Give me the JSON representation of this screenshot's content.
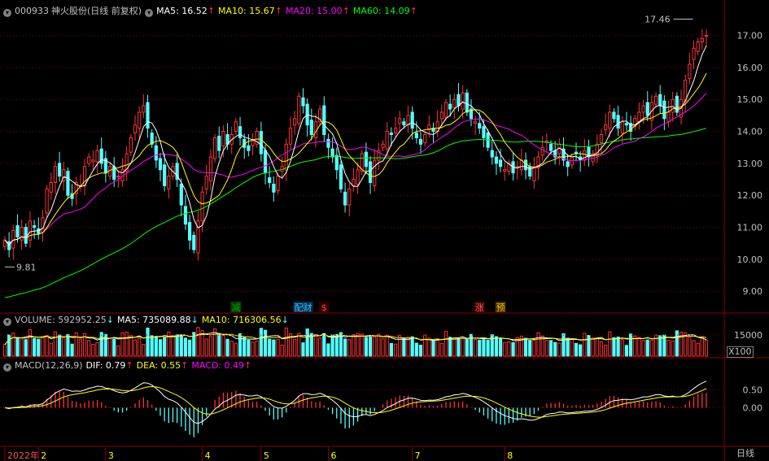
{
  "price_header": {
    "code": "000933",
    "name": "神火股份(日线 前复权)",
    "ma5": "MA5: 16.52",
    "ma10": "MA10: 15.67",
    "ma20": "MA20: 15.00",
    "ma60": "MA60: 14.09",
    "arrow_up": "↑"
  },
  "volume_header": {
    "label": "VOLUME: 592952.25",
    "ma5": "MA5: 735089.88",
    "ma10": "MA10: 716306.56",
    "arrow_down": "↓"
  },
  "macd_header": {
    "label": "MACD(12,26,9)",
    "dif": "DIF: 0.79",
    "dea": "DEA: 0.55",
    "macd": "MACD: 0.49",
    "arrow_up": "↑"
  },
  "annotations": {
    "high_label": "17.46",
    "low_label": "9.81",
    "events": [
      {
        "text": "减",
        "color": "#00a000",
        "bg": "#004000"
      },
      {
        "text": "配财",
        "color": "#40c0ff",
        "bg": "#003050"
      },
      {
        "text": "$",
        "color": "#ff4040",
        "bg": "#300000"
      },
      {
        "text": "涨",
        "color": "#ff6060",
        "bg": "#400000"
      },
      {
        "text": "预",
        "color": "#ffc000",
        "bg": "#403000"
      }
    ]
  },
  "axis": {
    "x_labels": [
      "2022年",
      "2",
      "3",
      "4",
      "5",
      "6",
      "7",
      "8"
    ],
    "period_label": "日线",
    "volume_unit": "X100",
    "volume_ticks": [
      "15000"
    ],
    "macd_ticks": [
      "0.50",
      "0.00"
    ]
  },
  "colors": {
    "up": "#ff3232",
    "down": "#54ffff",
    "ma5": "#ffffff",
    "ma10": "#ffff00",
    "ma20": "#ff00ff",
    "ma60": "#00ff00",
    "grid": "#8b0000"
  },
  "chart_data": {
    "type": "candlestick",
    "title": "000933 神火股份(日线 前复权)",
    "price_ylim": [
      8.7,
      17.6
    ],
    "price_ticks": [
      9.0,
      10.0,
      11.0,
      12.0,
      13.0,
      14.0,
      15.0,
      16.0,
      17.0
    ],
    "macd_ylim": [
      -1.05,
      1.05
    ],
    "volume_ylim": [
      0,
      22000
    ],
    "ma60_start": 8.8,
    "last_values": {
      "ma5": 16.52,
      "ma10": 15.67,
      "ma20": 15.0,
      "ma60": 14.09,
      "volume": 592952.25,
      "vol_ma5": 735089.88,
      "vol_ma10": 716306.56,
      "dif": 0.79,
      "dea": 0.55,
      "macd": 0.49
    },
    "high": 17.46,
    "low": 9.81,
    "months": [
      "2022年",
      "2",
      "3",
      "4",
      "5",
      "6",
      "7",
      "8"
    ],
    "closes": [
      10.6,
      10.3,
      10.9,
      10.7,
      11.0,
      10.5,
      11.2,
      11.0,
      10.8,
      11.3,
      12.2,
      12.4,
      12.9,
      12.6,
      12.8,
      12.0,
      11.9,
      12.4,
      12.3,
      12.9,
      13.2,
      13.1,
      13.4,
      13.0,
      12.7,
      12.9,
      12.5,
      12.6,
      12.8,
      13.3,
      13.8,
      14.2,
      14.6,
      14.8,
      14.1,
      13.6,
      13.1,
      12.8,
      12.3,
      12.6,
      12.9,
      12.5,
      11.7,
      11.1,
      10.6,
      10.3,
      11.2,
      12.1,
      12.6,
      13.2,
      13.8,
      13.4,
      14.0,
      13.6,
      13.9,
      14.3,
      13.8,
      13.5,
      13.4,
      13.7,
      14.0,
      13.3,
      12.7,
      12.4,
      12.1,
      12.6,
      12.9,
      13.6,
      14.1,
      14.4,
      15.1,
      14.8,
      14.2,
      13.9,
      14.3,
      14.7,
      13.9,
      13.5,
      13.2,
      12.8,
      12.2,
      11.7,
      12.2,
      12.5,
      12.8,
      13.3,
      12.9,
      12.4,
      13.1,
      13.4,
      13.6,
      14.0,
      13.9,
      14.1,
      14.4,
      14.2,
      14.5,
      14.1,
      13.8,
      13.6,
      13.9,
      14.2,
      14.0,
      14.3,
      14.6,
      14.9,
      14.7,
      15.0,
      14.8,
      15.2,
      14.6,
      14.4,
      14.3,
      14.1,
      13.8,
      13.5,
      13.2,
      13.0,
      12.9,
      12.8,
      13.0,
      12.7,
      12.9,
      13.1,
      12.8,
      12.6,
      12.9,
      13.2,
      13.5,
      13.7,
      13.4,
      13.2,
      13.6,
      13.1,
      12.9,
      13.2,
      13.3,
      13.1,
      13.4,
      13.2,
      13.3,
      13.6,
      13.9,
      14.2,
      14.6,
      14.4,
      14.1,
      14.3,
      14.2,
      14.0,
      14.4,
      14.6,
      14.8,
      14.5,
      14.9,
      15.1,
      14.8,
      14.4,
      14.6,
      15.0,
      14.6,
      15.0,
      15.6,
      16.1,
      16.6,
      16.8,
      16.9,
      17.0
    ]
  }
}
